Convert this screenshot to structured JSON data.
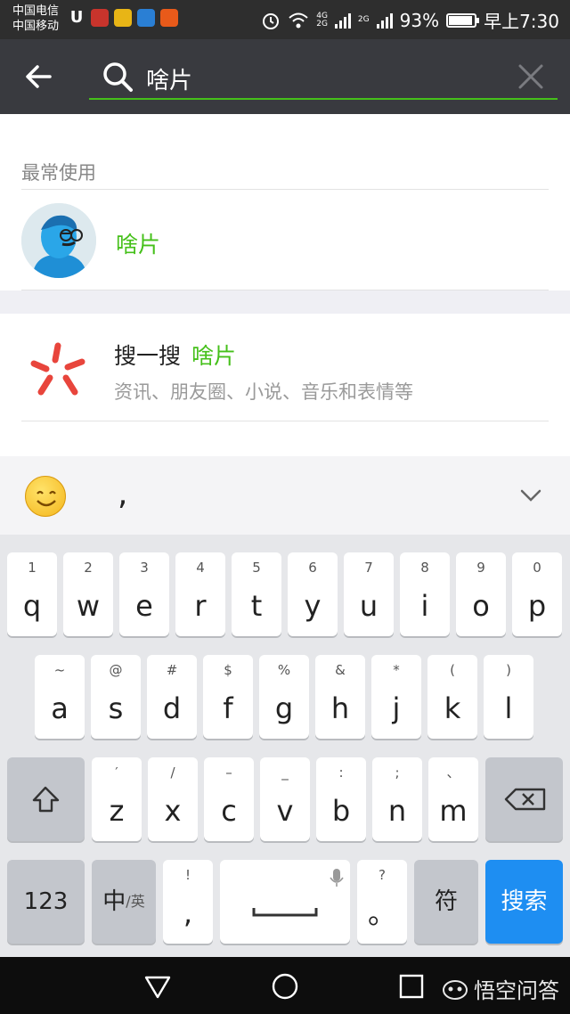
{
  "status_bar": {
    "carrier_1": "中国电信",
    "carrier_2": "中国移动",
    "net_1_top": "4G",
    "net_1_bottom": "2G",
    "net_2": "2G",
    "battery": "93%",
    "battery_level": 0.93,
    "time": "早上7:30",
    "notification_icons": [
      "u-icon",
      "news-app-icon",
      "taxi-app-icon",
      "video-app-icon",
      "taobao-app-icon"
    ]
  },
  "search": {
    "query": "啥片",
    "accent_color": "#45c01a"
  },
  "sections": {
    "frequent_title": "最常使用",
    "contact_name": "啥片",
    "sousou_label": "搜一搜",
    "sousou_query": "啥片",
    "sousou_desc": "资讯、朋友圈、小说、音乐和表情等"
  },
  "keyboard": {
    "candidate_comma": ",",
    "row1": [
      {
        "sub": "1",
        "main": "q"
      },
      {
        "sub": "2",
        "main": "w"
      },
      {
        "sub": "3",
        "main": "e"
      },
      {
        "sub": "4",
        "main": "r"
      },
      {
        "sub": "5",
        "main": "t"
      },
      {
        "sub": "6",
        "main": "y"
      },
      {
        "sub": "7",
        "main": "u"
      },
      {
        "sub": "8",
        "main": "i"
      },
      {
        "sub": "9",
        "main": "o"
      },
      {
        "sub": "0",
        "main": "p"
      }
    ],
    "row2": [
      {
        "sub": "~",
        "main": "a"
      },
      {
        "sub": "@",
        "main": "s"
      },
      {
        "sub": "#",
        "main": "d"
      },
      {
        "sub": "$",
        "main": "f"
      },
      {
        "sub": "%",
        "main": "g"
      },
      {
        "sub": "&",
        "main": "h"
      },
      {
        "sub": "*",
        "main": "j"
      },
      {
        "sub": "(",
        "main": "k"
      },
      {
        "sub": ")",
        "main": "l"
      }
    ],
    "row3": [
      {
        "sub": "′",
        "main": "z"
      },
      {
        "sub": "/",
        "main": "x"
      },
      {
        "sub": "–",
        "main": "c"
      },
      {
        "sub": "_",
        "main": "v"
      },
      {
        "sub": ":",
        "main": "b"
      },
      {
        "sub": ";",
        "main": "n"
      },
      {
        "sub": "、",
        "main": "m"
      }
    ],
    "num_key": "123",
    "lang_key_main": "中",
    "lang_key_sub": "/英",
    "comma_sub": "!",
    "comma_main": ",",
    "period_sub": "?",
    "period_main": "。",
    "symbol_key": "符",
    "search_key": "搜索",
    "search_key_color": "#1e8ef2"
  },
  "watermark": "悟空问答"
}
